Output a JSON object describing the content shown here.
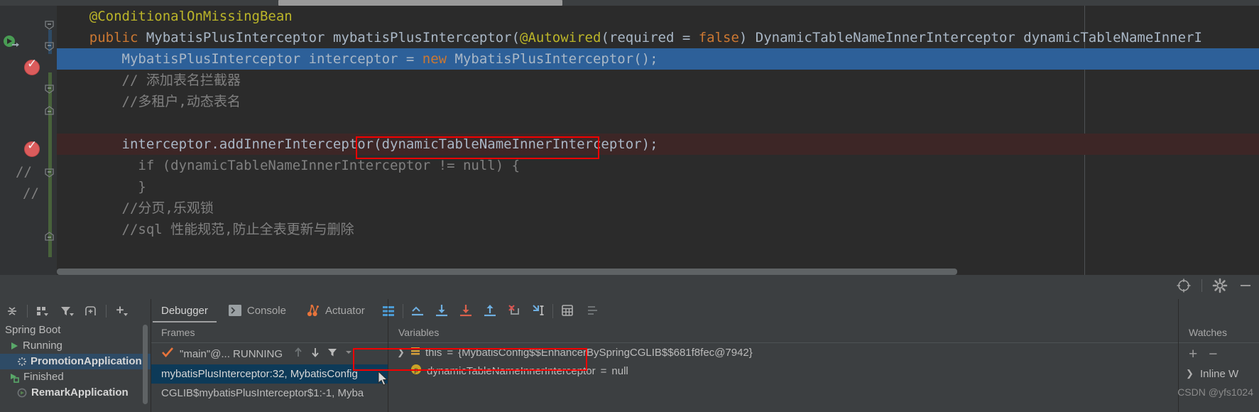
{
  "editor": {
    "lines": [
      {
        "indent": "    ",
        "segments": [
          {
            "t": "@ConditionalOnMissingBean",
            "c": "ann"
          }
        ]
      },
      {
        "indent": "    ",
        "segments": [
          {
            "t": "public ",
            "c": "kw"
          },
          {
            "t": "MybatisPlusInterceptor mybatisPlusInterceptor(",
            "c": "typ"
          },
          {
            "t": "@Autowired",
            "c": "ann"
          },
          {
            "t": "(required = ",
            "c": "typ"
          },
          {
            "t": "false",
            "c": "kw"
          },
          {
            "t": ") DynamicTableNameInnerInterceptor dynamicTableNameInnerI",
            "c": "typ"
          }
        ]
      },
      {
        "indent": "        ",
        "highlight": "sel",
        "segments": [
          {
            "t": "MybatisPlusInterceptor interceptor = ",
            "c": "typ"
          },
          {
            "t": "new ",
            "c": "kw"
          },
          {
            "t": "MybatisPlusInterceptor()",
            "c": "typ"
          },
          {
            "t": ";",
            "c": "sep"
          }
        ]
      },
      {
        "indent": "        ",
        "segments": [
          {
            "t": "// 添加表名拦截器",
            "c": "cmt"
          }
        ]
      },
      {
        "indent": "        ",
        "segments": [
          {
            "t": "//多租户,动态表名",
            "c": "cmt"
          }
        ]
      },
      {
        "indent": "",
        "segments": []
      },
      {
        "indent": "        ",
        "highlight": "err",
        "segments": [
          {
            "t": "interceptor.addInnerInterceptor(dynamicTableNameInnerInterceptor)",
            "c": "typ"
          },
          {
            "t": ";",
            "c": "sep"
          }
        ]
      },
      {
        "indent": "          ",
        "segments": [
          {
            "t": "if (dynamicTableNameInnerInterceptor != null) {",
            "c": "cmt"
          }
        ]
      },
      {
        "indent": "          ",
        "segments": [
          {
            "t": "}",
            "c": "cmt"
          }
        ]
      },
      {
        "indent": "        ",
        "segments": [
          {
            "t": "//分页,乐观锁",
            "c": "cmt"
          }
        ]
      },
      {
        "indent": "        ",
        "segments": [
          {
            "t": "//sql 性能规范,防止全表更新与删除",
            "c": "cmt"
          }
        ]
      }
    ],
    "comment_markers": [
      "//",
      "//"
    ],
    "gutter_icons": {
      "run_method": "run-gutter-icon",
      "breakpoint_1": "breakpoint-verified-icon",
      "breakpoint_2": "breakpoint-verified-icon"
    }
  },
  "toolwindow": {
    "header_icons": [
      "crosshair-settings-icon",
      "gear-icon",
      "minimize-icon"
    ],
    "run_toolbar_icons": [
      "collapse-all-icon",
      "group-by-icon",
      "filter-icon",
      "add-tab-icon",
      "add-icon"
    ],
    "run_tree": [
      {
        "label": "Spring Boot",
        "icon": "none",
        "bold": false,
        "selected": false,
        "indent": 0
      },
      {
        "label": "Running",
        "icon": "green-play-icon",
        "bold": false,
        "selected": false,
        "indent": 1
      },
      {
        "label": "PromotionApplication",
        "icon": "spinner-icon",
        "bold": true,
        "selected": true,
        "indent": 2
      },
      {
        "label": "Finished",
        "icon": "green-rerun-icon",
        "bold": false,
        "selected": false,
        "indent": 1
      },
      {
        "label": "RemarkApplication",
        "icon": "gray-app-icon",
        "bold": true,
        "selected": false,
        "indent": 2
      }
    ]
  },
  "debugger": {
    "tabs": [
      {
        "label": "Debugger",
        "icon": "none",
        "active": true
      },
      {
        "label": "Console",
        "icon": "console-icon",
        "active": false
      },
      {
        "label": "Actuator",
        "icon": "actuator-icon",
        "active": false
      }
    ],
    "step_icons": [
      "layout-settings-icon",
      "show-execution-point-icon",
      "step-over-icon",
      "step-into-icon",
      "step-out-icon",
      "force-step-into-icon",
      "run-to-cursor-icon",
      "evaluate-expression-icon",
      "mute-breakpoints-icon"
    ],
    "frames": {
      "title": "Frames",
      "thread": "\"main\"@... RUNNING",
      "thread_icons": [
        "check-icon",
        "up-arrow-icon",
        "down-arrow-icon",
        "filter-icon",
        "chevron-down-icon"
      ],
      "items": [
        {
          "label": "mybatisPlusInterceptor:32, MybatisConfig",
          "selected": true
        },
        {
          "label": "CGLIB$mybatisPlusInterceptor$1:-1, Myba",
          "selected": false
        }
      ]
    },
    "variables": {
      "title": "Variables",
      "items": [
        {
          "icon": "object-field-icon",
          "expandable": true,
          "name": "this",
          "eq": " = ",
          "value": "{MybatisConfig$$EnhancerBySpringCGLIB$$681f8fec@7942}"
        },
        {
          "icon": "parameter-icon",
          "expandable": false,
          "name": "dynamicTableNameInnerInterceptor",
          "eq": " = ",
          "value": "null"
        }
      ]
    },
    "watches": {
      "title": "Watches",
      "add_label": "+",
      "remove_label": "−",
      "item": "Inline W"
    }
  },
  "watermark": "CSDN @yfs1024",
  "colors": {
    "editor_bg": "#2B2B2B",
    "gutter_bg": "#313335",
    "selection_blue": "#2D6099",
    "error_line": "#3D2626",
    "panel_bg": "#3C3F41",
    "frame_selected": "#0D3A58",
    "tree_selected": "#2E4B66",
    "red_annotation": "#F20000",
    "keyword": "#CC7832",
    "annotation": "#BBB529",
    "comment": "#808080",
    "text": "#A9B7C6"
  }
}
